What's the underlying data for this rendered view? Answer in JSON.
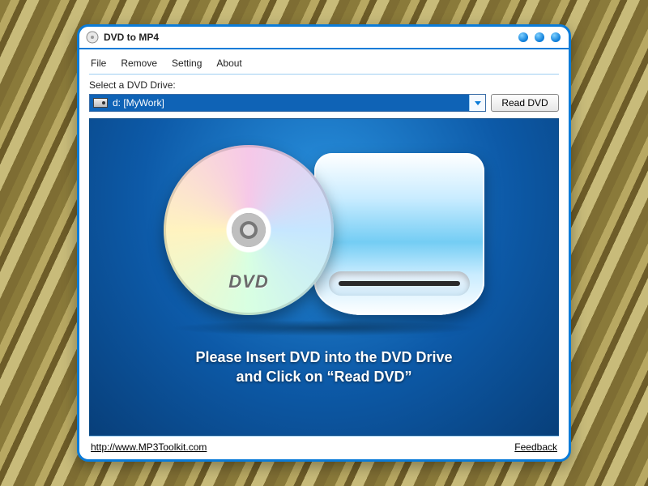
{
  "window": {
    "title": "DVD to MP4"
  },
  "menu": {
    "file": "File",
    "remove": "Remove",
    "setting": "Setting",
    "about": "About"
  },
  "drive": {
    "label": "Select a DVD Drive:",
    "selected": "d: [MyWork]",
    "read_button": "Read DVD"
  },
  "art": {
    "disc_label": "DVD"
  },
  "instruction": {
    "line1": "Please Insert DVD into the DVD Drive",
    "line2": "and Click on “Read DVD”"
  },
  "footer": {
    "url": "http://www.MP3Toolkit.com",
    "feedback": "Feedback"
  }
}
